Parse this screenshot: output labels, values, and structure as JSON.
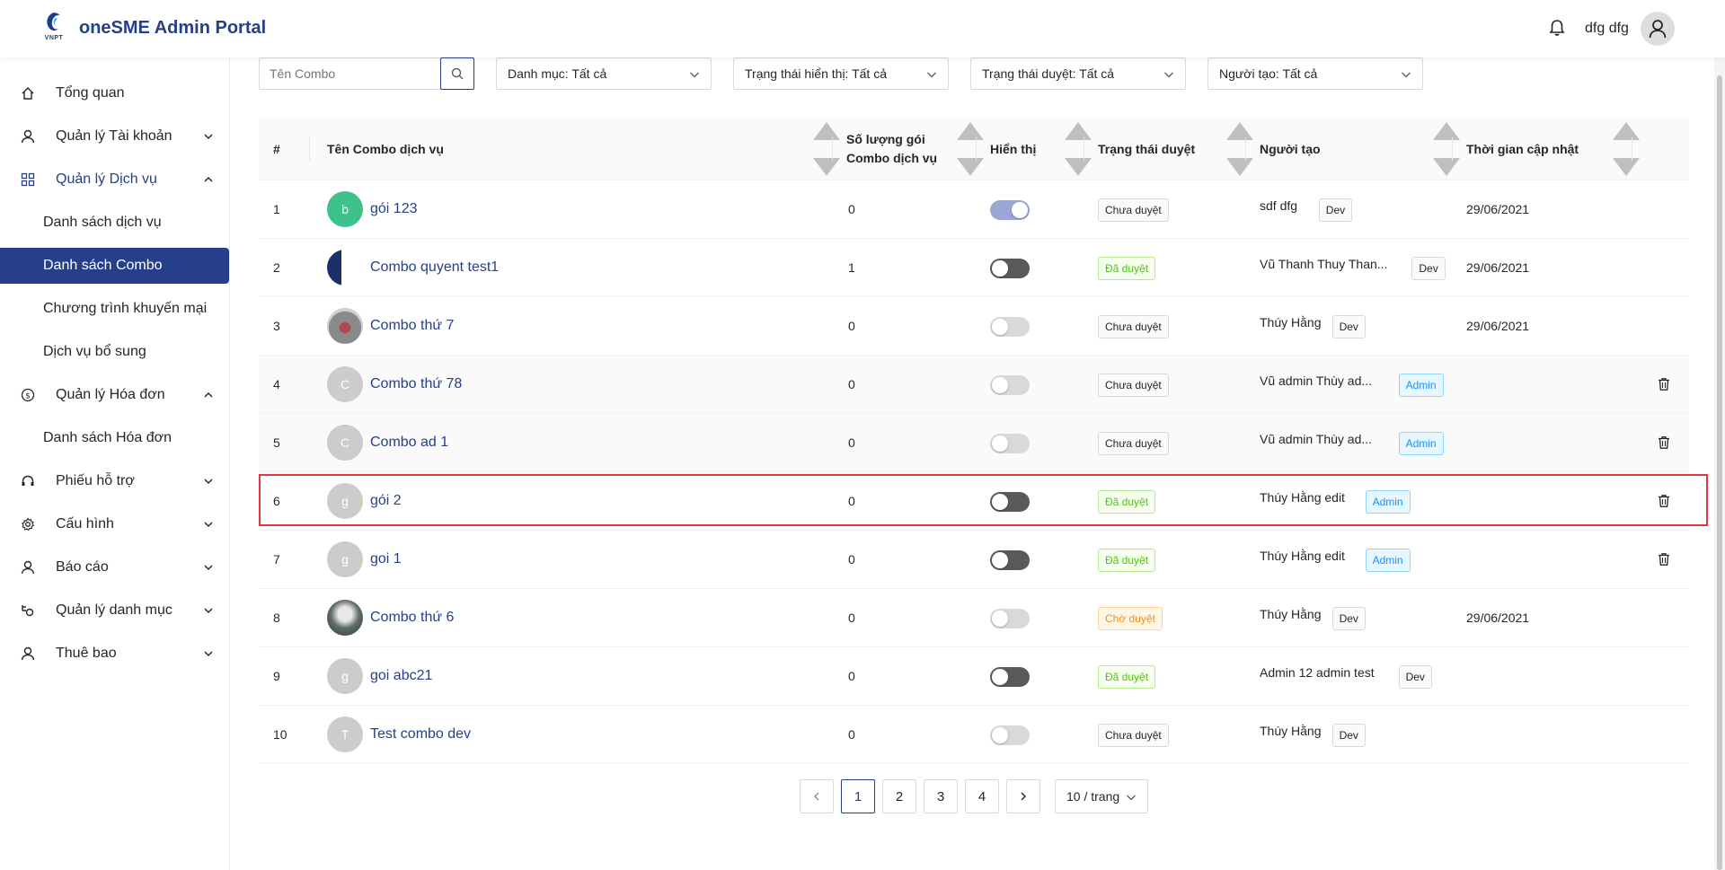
{
  "header": {
    "logo_text": "VNPT",
    "title": "oneSME Admin Portal",
    "username": "dfg dfg"
  },
  "sidebar": {
    "items": [
      {
        "label": "Tổng quan",
        "icon": "home-icon"
      },
      {
        "label": "Quản lý Tài khoản",
        "icon": "user-icon"
      },
      {
        "label": "Quản lý Dịch vụ",
        "icon": "appstore-icon"
      },
      {
        "label": "Quản lý Hóa đơn",
        "icon": "dollar-icon"
      },
      {
        "label": "Phiếu hỗ trợ",
        "icon": "headset-icon"
      },
      {
        "label": "Cấu hình",
        "icon": "settings-icon"
      },
      {
        "label": "Báo cáo",
        "icon": "user-icon"
      },
      {
        "label": "Quản lý danh mục",
        "icon": "category-icon"
      },
      {
        "label": "Thuê bao",
        "icon": "user-icon"
      }
    ],
    "service_sub": [
      "Danh sách dịch vụ",
      "Danh sách Combo",
      "Chương trình khuyến mại",
      "Dịch vụ bổ sung"
    ],
    "invoice_sub": [
      "Danh sách Hóa đơn"
    ]
  },
  "filters": {
    "search_placeholder": "Tên Combo",
    "category": "Danh mục: Tất cả",
    "display_status": "Trạng thái hiển thị: Tất cả",
    "approval_status": "Trạng thái duyệt: Tất cả",
    "creator": "Người tạo: Tất cả"
  },
  "table": {
    "columns": {
      "index": "#",
      "name": "Tên Combo dịch vụ",
      "qty_line1": "Số lượng gói",
      "qty_line2": "Combo dịch vụ",
      "display": "Hiển thị",
      "status": "Trạng thái duyệt",
      "creator": "Người tạo",
      "updated": "Thời gian cập nhật"
    },
    "rows": [
      {
        "index": "1",
        "name": "gói 123",
        "qty": "0",
        "display": "on",
        "status": "Chưa duyệt",
        "creator": "sdf dfg",
        "role": "Dev",
        "updated": "29/06/2021",
        "thumb": "b",
        "delete": false
      },
      {
        "index": "2",
        "name": "Combo quyent test1",
        "qty": "1",
        "display": "off",
        "status": "Đã duyệt",
        "creator": "Vũ Thanh Thuy Than...",
        "role": "Dev",
        "updated": "29/06/2021",
        "thumb": "",
        "delete": false
      },
      {
        "index": "3",
        "name": "Combo thứ 7",
        "qty": "0",
        "display": "off",
        "status": "Chưa duyệt",
        "creator": "Thúy Hằng",
        "role": "Dev",
        "updated": "29/06/2021",
        "thumb": "",
        "delete": false
      },
      {
        "index": "4",
        "name": "Combo thứ 78",
        "qty": "0",
        "display": "off",
        "status": "Chưa duyệt",
        "creator": "Vũ admin Thùy ad...",
        "role": "Admin",
        "updated": "",
        "thumb": "C",
        "delete": true
      },
      {
        "index": "5",
        "name": "Combo ad 1",
        "qty": "0",
        "display": "off",
        "status": "Chưa duyệt",
        "creator": "Vũ admin Thùy ad...",
        "role": "Admin",
        "updated": "",
        "thumb": "C",
        "delete": true
      },
      {
        "index": "6",
        "name": "gói 2",
        "qty": "0",
        "display": "off",
        "status": "Đã duyệt",
        "creator": "Thúy Hằng edit",
        "role": "Admin",
        "updated": "",
        "thumb": "g",
        "delete": true
      },
      {
        "index": "7",
        "name": "goi 1",
        "qty": "0",
        "display": "off",
        "status": "Đã duyệt",
        "creator": "Thúy Hằng edit",
        "role": "Admin",
        "updated": "",
        "thumb": "g",
        "delete": true
      },
      {
        "index": "8",
        "name": "Combo thứ 6",
        "qty": "0",
        "display": "off",
        "status": "Chờ duyệt",
        "creator": "Thúy Hằng",
        "role": "Dev",
        "updated": "29/06/2021",
        "thumb": "",
        "delete": false
      },
      {
        "index": "9",
        "name": "goi abc21",
        "qty": "0",
        "display": "off",
        "status": "Đã duyệt",
        "creator": "Admin 12 admin test",
        "role": "Dev",
        "updated": "",
        "thumb": "g",
        "delete": false
      },
      {
        "index": "10",
        "name": "Test combo dev",
        "qty": "0",
        "display": "off",
        "status": "Chưa duyệt",
        "creator": "Thúy Hằng",
        "role": "Dev",
        "updated": "",
        "thumb": "T",
        "delete": false
      }
    ]
  },
  "pagination": {
    "pages": [
      "1",
      "2",
      "3",
      "4"
    ],
    "current": "1",
    "page_size": "10 / trang"
  },
  "colors": {
    "brand": "#253f8a",
    "approved": "#52c41a",
    "pending": "#fa8c16",
    "admin": "#1890ff",
    "highlight": "#e0383e"
  }
}
